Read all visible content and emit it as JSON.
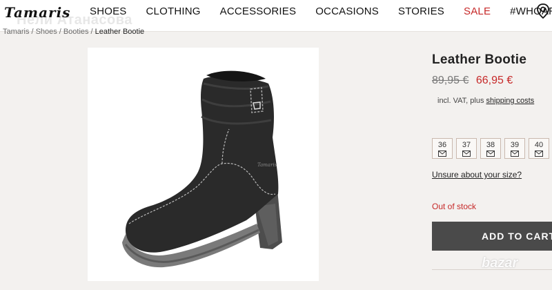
{
  "header": {
    "logo": "Tamaris",
    "nav": [
      "SHOES",
      "CLOTHING",
      "ACCESSORIES",
      "OCCASIONS",
      "STORIES",
      "SALE",
      "#WHOAREYO"
    ],
    "sale_color": "#c62828"
  },
  "watermark": "Нели Атанасова",
  "breadcrumb": [
    "Tamaris",
    "Shoes",
    "Booties",
    "Leather Bootie"
  ],
  "product": {
    "title": "Leather Bootie",
    "old_price": "89,95 €",
    "new_price": "66,95 €",
    "vat_text": "incl. VAT, plus",
    "shipping_link": "shipping costs",
    "sizes": [
      "36",
      "37",
      "38",
      "39",
      "40"
    ],
    "size_help": "Unsure about your size?",
    "stock_status": "Out of stock",
    "add_to_cart": "ADD TO CART"
  },
  "overlay_logo": "bazar",
  "colors": {
    "accent_red": "#c62828",
    "button_bg": "#4a4a4a",
    "page_bg": "#f3f1ef"
  }
}
